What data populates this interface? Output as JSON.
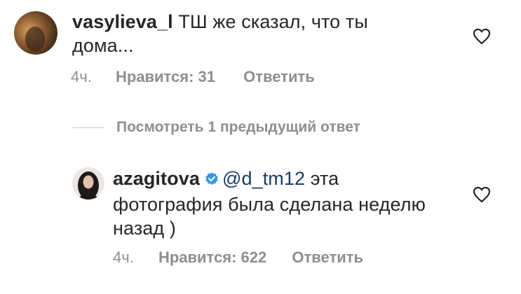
{
  "comments": [
    {
      "username": "vasylieva_l",
      "text": " ТШ же сказал, что ты",
      "text_line2": "дома...",
      "time": "4ч.",
      "likes_label": "Нравится: 31",
      "reply_label": "Ответить"
    },
    {
      "username": "azagitova",
      "verified": true,
      "mention": "@d_tm12",
      "text": " эта",
      "text_line2": "фотография была сделана неделю",
      "text_line3": "назад )",
      "time": "4ч.",
      "likes_label": "Нравится: 622",
      "reply_label": "Ответить"
    }
  ],
  "view_replies_label": "Посмотреть 1 предыдущий ответ",
  "icons": {
    "like": "heart-outline-icon",
    "verified": "verified-badge-icon"
  },
  "colors": {
    "verified": "#3897f0",
    "muted": "#8e8e8e",
    "mention": "#1b3a63"
  }
}
